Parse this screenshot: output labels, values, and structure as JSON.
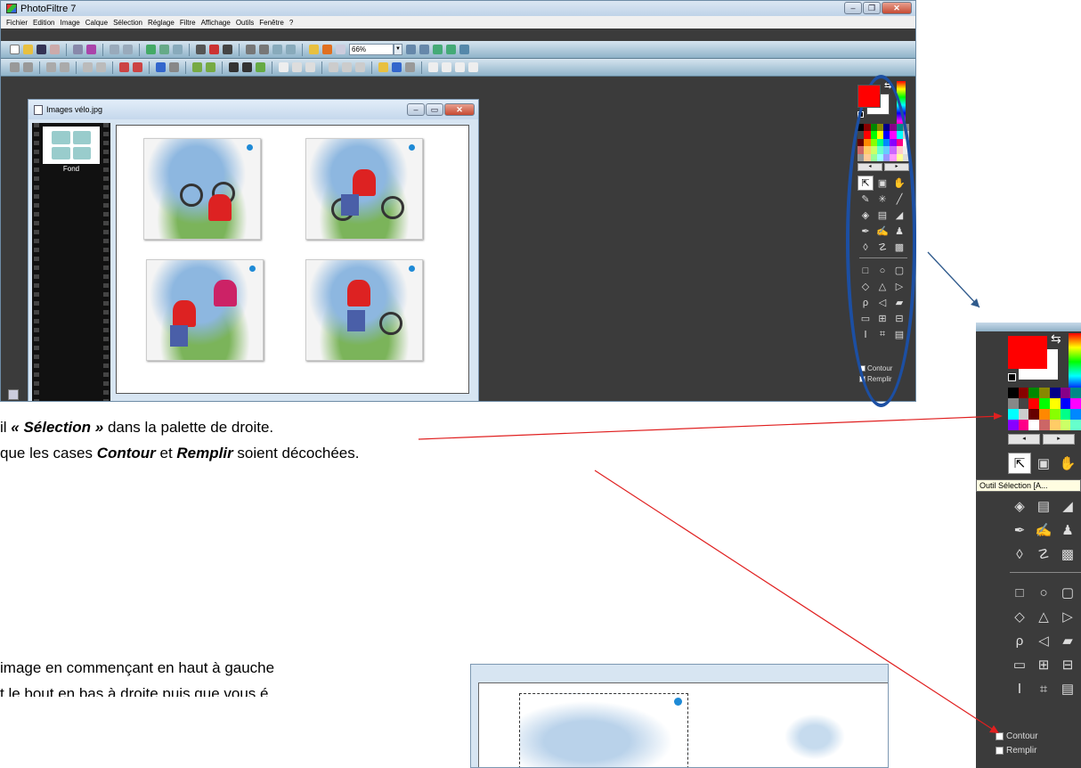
{
  "app": {
    "title": "PhotoFiltre 7",
    "menu": [
      "Fichier",
      "Edition",
      "Image",
      "Calque",
      "Sélection",
      "Réglage",
      "Filtre",
      "Affichage",
      "Outils",
      "Fenêtre",
      "?"
    ],
    "zoom": "66%"
  },
  "image_window": {
    "title": "Images vélo.jpg",
    "layer_label": "Fond"
  },
  "palette": {
    "fg_color": "#ff0000",
    "bg_color": "#ffffff",
    "contour_label": "Contour",
    "remplir_label": "Remplir",
    "contour_label_cut": "Contour",
    "remplir_label_cut": "Remplir"
  },
  "zoom_panel": {
    "tooltip": "Outil Sélection [A...",
    "contour_label": "Contour",
    "remplir_label": "Remplir"
  },
  "instructions": {
    "line1_pre": "il ",
    "line1_em": "« Sélection »",
    "line1_post": " dans la palette de droite.",
    "line2_pre": "que les cases ",
    "line2_em1": "Contour",
    "line2_mid": " et ",
    "line2_em2": "Remplir",
    "line2_post": " soient décochées.",
    "line3": "image en commençant en haut à gauche",
    "line4": "t le bout en bas à droite puis que vous é"
  },
  "colors": {
    "highlight_oval": "#1c4fa3",
    "arrow_blue": "#2f5a8c",
    "arrow_red": "#e02020",
    "workspace": "#3b3b3b"
  }
}
